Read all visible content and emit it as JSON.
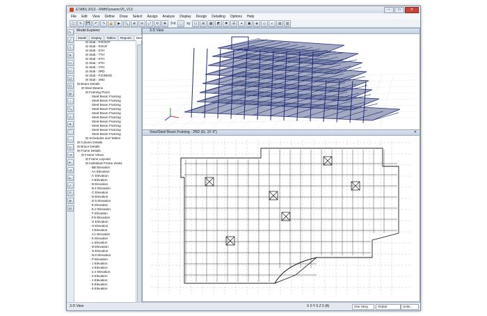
{
  "window": {
    "title": "ETABS 2013 - RMHDynamicV5_V13"
  },
  "menu": [
    "File",
    "Edit",
    "View",
    "Define",
    "Draw",
    "Select",
    "Assign",
    "Analyze",
    "Display",
    "Design",
    "Detailing",
    "Options",
    "Help"
  ],
  "toolbar": {
    "view_label": "3-d",
    "pln_label": "xy"
  },
  "explorer": {
    "title": "Model Explorer",
    "tabs": [
      "Model",
      "Display",
      "Tables",
      "Reports",
      "Detailing"
    ],
    "tree": [
      {
        "indent": 2,
        "label": "Slab - P.ROOF"
      },
      {
        "indent": 2,
        "label": "Slab - ROOF"
      },
      {
        "indent": 2,
        "label": "Slab - 8TH"
      },
      {
        "indent": 2,
        "label": "Slab - 7TH"
      },
      {
        "indent": 2,
        "label": "Slab - 6TH"
      },
      {
        "indent": 2,
        "label": "Slab - 5TH"
      },
      {
        "indent": 2,
        "label": "Slab - 4TH"
      },
      {
        "indent": 2,
        "label": "Slab - 3RD"
      },
      {
        "indent": 2,
        "label": "Slab - P.DINING"
      },
      {
        "indent": 2,
        "label": "Slab - 2ND"
      },
      {
        "indent": 0,
        "label": "Beam Details"
      },
      {
        "indent": 1,
        "label": "Steel Beams"
      },
      {
        "indent": 2,
        "label": "Framing Plans"
      },
      {
        "indent": 3,
        "label": "Steel Beam Framing"
      },
      {
        "indent": 3,
        "label": "Steel Beam Framing"
      },
      {
        "indent": 3,
        "label": "Steel Beam Framing"
      },
      {
        "indent": 3,
        "label": "Steel Beam Framing"
      },
      {
        "indent": 3,
        "label": "Steel Beam Framing"
      },
      {
        "indent": 3,
        "label": "Steel Beam Framing"
      },
      {
        "indent": 3,
        "label": "Steel Beam Framing"
      },
      {
        "indent": 3,
        "label": "Steel Beam Framing"
      },
      {
        "indent": 3,
        "label": "Steel Beam Framing"
      },
      {
        "indent": 3,
        "label": "Steel Beam Framing"
      },
      {
        "indent": 2,
        "label": "Schedules and Tables"
      },
      {
        "indent": 0,
        "label": "Column Details"
      },
      {
        "indent": 0,
        "label": "Brace Details"
      },
      {
        "indent": 0,
        "label": "Frame Details"
      },
      {
        "indent": 1,
        "label": "Frame Views"
      },
      {
        "indent": 2,
        "label": "Frame Layouts"
      },
      {
        "indent": 2,
        "label": "Individual Frame Views"
      },
      {
        "indent": 3,
        "label": "BB Elevation"
      },
      {
        "indent": 3,
        "label": "AA Elevation"
      },
      {
        "indent": 3,
        "label": "A' Elevation"
      },
      {
        "indent": 3,
        "label": "A Elevation"
      },
      {
        "indent": 3,
        "label": "B Elevation"
      },
      {
        "indent": 3,
        "label": "B.4 Elevation"
      },
      {
        "indent": 3,
        "label": "C Elevation"
      },
      {
        "indent": 3,
        "label": "D Elevation"
      },
      {
        "indent": 3,
        "label": "D.5 Elevation"
      },
      {
        "indent": 3,
        "label": "E Elevation"
      },
      {
        "indent": 3,
        "label": "E.2 Elevation"
      },
      {
        "indent": 3,
        "label": "F Elevation"
      },
      {
        "indent": 3,
        "label": "F.5 Elevation"
      },
      {
        "indent": 3,
        "label": "G Elevation"
      },
      {
        "indent": 3,
        "label": "H Elevation"
      },
      {
        "indent": 3,
        "label": "J Elevation"
      },
      {
        "indent": 3,
        "label": "J.1 Elevation"
      },
      {
        "indent": 3,
        "label": "K Elevation"
      },
      {
        "indent": 3,
        "label": "L Elevation"
      },
      {
        "indent": 3,
        "label": "M Elevation"
      },
      {
        "indent": 3,
        "label": "N Elevation"
      },
      {
        "indent": 3,
        "label": "N.6 Elevation"
      },
      {
        "indent": 3,
        "label": "P Elevation"
      },
      {
        "indent": 3,
        "label": "1 Elevation"
      },
      {
        "indent": 3,
        "label": "2 Elevation"
      },
      {
        "indent": 3,
        "label": "2.4 Elevation"
      },
      {
        "indent": 3,
        "label": "3 Elevation"
      },
      {
        "indent": 3,
        "label": "4 Elevation"
      },
      {
        "indent": 3,
        "label": "5 Elevation"
      },
      {
        "indent": 3,
        "label": "6 Elevation"
      }
    ]
  },
  "view3d": {
    "title": "3-D View"
  },
  "planview": {
    "title": "View/Steel Beam Framing - 2ND (EL 15'-0\")"
  },
  "status": {
    "left": "3-D View",
    "coords": "X 0  Y 0  Z 0 (ft)",
    "story_mode": "One Story",
    "coord_sys": "Global",
    "units": "Units..."
  },
  "colors": {
    "member": "#1f2a78",
    "slab": "#5b678f",
    "window_frame": "#7a8ba0"
  }
}
